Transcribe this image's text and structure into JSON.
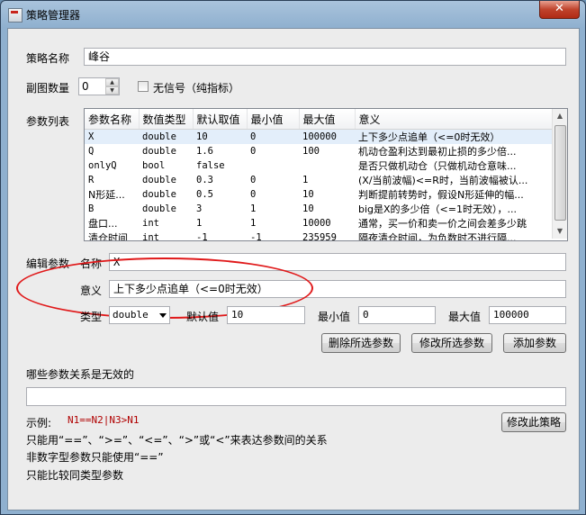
{
  "window": {
    "title": "策略管理器",
    "close_glyph": "✕"
  },
  "strategy": {
    "name_label": "策略名称",
    "name_value": "峰谷"
  },
  "subchart": {
    "label": "副图数量",
    "value": "0",
    "no_signal_label": "无信号（纯指标）"
  },
  "params": {
    "label": "参数列表",
    "columns": [
      "参数名称",
      "数值类型",
      "默认取值",
      "最小值",
      "最大值",
      "意义"
    ],
    "rows": [
      [
        "X",
        "double",
        "10",
        "0",
        "100000",
        "上下多少点追单（<=0时无效）"
      ],
      [
        "Q",
        "double",
        "1.6",
        "0",
        "100",
        "机动仓盈利达到最初止损的多少倍..."
      ],
      [
        "onlyQ",
        "bool",
        "false",
        "",
        "",
        "是否只做机动仓（只做机动仓意味..."
      ],
      [
        "R",
        "double",
        "0.3",
        "0",
        "1",
        "(X/当前波幅)<=R时，当前波幅被认..."
      ],
      [
        "N形延...",
        "double",
        "0.5",
        "0",
        "10",
        "判断提前转势时，假设N形延伸的幅..."
      ],
      [
        "B",
        "double",
        "3",
        "1",
        "10",
        "big是X的多少倍（<=1时无效），..."
      ],
      [
        "盘口...",
        "int",
        "1",
        "1",
        "10000",
        "通常，买一价和卖一价之间会差多少跳"
      ],
      [
        "清仓时间",
        "int",
        "-1",
        "-1",
        "235959",
        "隔夜清仓时间，为负数时不进行隔..."
      ]
    ]
  },
  "edit": {
    "section_label": "编辑参数",
    "name_label": "名称",
    "name_value": "X",
    "meaning_label": "意义",
    "meaning_value": "上下多少点追单（<=0时无效）",
    "type_label": "类型",
    "type_value": "double",
    "default_label": "默认值",
    "default_value": "10",
    "min_label": "最小值",
    "min_value": "0",
    "max_label": "最大值",
    "max_value": "100000"
  },
  "buttons": {
    "delete": "删除所选参数",
    "modify": "修改所选参数",
    "add": "添加参数",
    "modify_strategy": "修改此策略"
  },
  "relations": {
    "label": "哪些参数关系是无效的",
    "value": "",
    "example_label": "示例:",
    "example_value": "N1==N2|N3>N1",
    "hint1": "只能用“==”、“>=”、“<=”、“>”或“<”来表达参数间的关系",
    "hint2": "非数字型参数只能使用“==”",
    "hint3": "只能比较同类型参数"
  },
  "colors": {
    "annotation_ellipse": "#e0191a",
    "example_text": "#b00000"
  }
}
